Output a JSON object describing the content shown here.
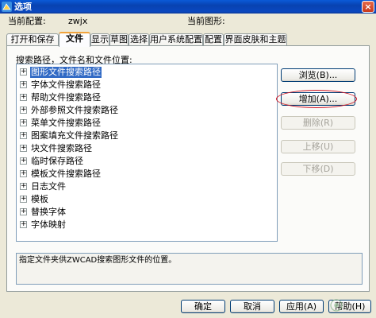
{
  "window": {
    "title": "选项",
    "close": "×"
  },
  "profile": {
    "label": "当前配置:",
    "value": "zwjx"
  },
  "drawing": {
    "label": "当前图形:",
    "value": ""
  },
  "tabs": [
    {
      "label": "打开和保存"
    },
    {
      "label": "文件",
      "active": true
    },
    {
      "label": "显示"
    },
    {
      "label": "草图"
    },
    {
      "label": "选择"
    },
    {
      "label": "用户系统配置"
    },
    {
      "label": "配置"
    },
    {
      "label": "界面皮肤和主题"
    }
  ],
  "files": {
    "heading": "搜索路径，文件名和文件位置:",
    "tree": [
      {
        "label": "图形文件搜索路径",
        "selected": true
      },
      {
        "label": "字体文件搜索路径"
      },
      {
        "label": "帮助文件搜索路径"
      },
      {
        "label": "外部参照文件搜索路径"
      },
      {
        "label": "菜单文件搜索路径"
      },
      {
        "label": "图案填充文件搜索路径"
      },
      {
        "label": "块文件搜索路径"
      },
      {
        "label": "临时保存路径"
      },
      {
        "label": "模板文件搜索路径"
      },
      {
        "label": "日志文件"
      },
      {
        "label": "模板"
      },
      {
        "label": "替换字体"
      },
      {
        "label": "字体映射"
      }
    ],
    "expander": "+",
    "buttons": {
      "browse": "浏览(B)...",
      "add": "增加(A)...",
      "remove": "删除(R)",
      "move_up": "上移(U)",
      "move_down": "下移(D)"
    },
    "description": "指定文件夹供ZWCAD搜索图形文件的位置。"
  },
  "footer": {
    "ok": "确定",
    "cancel": "取消",
    "apply": "应用(A)",
    "help": "帮助(H)"
  },
  "colors": {
    "title_bar": "#0842b0",
    "selection": "#316ac5",
    "highlight_ring": "#d01020"
  }
}
